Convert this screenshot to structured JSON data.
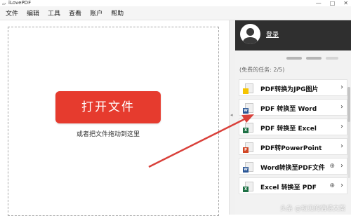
{
  "window": {
    "title": "iLovePDF"
  },
  "menu": [
    "文件",
    "编辑",
    "工具",
    "查看",
    "账户",
    "帮助"
  ],
  "main": {
    "open_button": "打开文件",
    "drop_hint": "或者把文件拖动到这里"
  },
  "account": {
    "login": "登录"
  },
  "free_tasks": "(免费的任务: 2/5)",
  "tools": [
    {
      "label": "PDF转换为JPG图片",
      "icon": "pdf-to-jpg-icon",
      "color": "#f5c400",
      "badge": "",
      "globe": false
    },
    {
      "label": "PDF 转换至 Word",
      "icon": "pdf-to-word-icon",
      "color": "#2b5797",
      "badge": "W",
      "globe": false
    },
    {
      "label": "PDF 转换至 Excel",
      "icon": "pdf-to-excel-icon",
      "color": "#1e7145",
      "badge": "X",
      "globe": false
    },
    {
      "label": "PDF转PowerPoint",
      "icon": "pdf-to-powerpoint-icon",
      "color": "#d24726",
      "badge": "P",
      "globe": false
    },
    {
      "label": "Word转换至PDF文件",
      "icon": "word-to-pdf-icon",
      "color": "#2b5797",
      "badge": "W",
      "globe": true
    },
    {
      "label": "Excel 转换至 PDF",
      "icon": "excel-to-pdf-icon",
      "color": "#1e7145",
      "badge": "X",
      "globe": true
    }
  ],
  "watermark": "头条 @初见的情感文案",
  "colors": {
    "accent": "#e63b2e",
    "header": "#2f2f2f",
    "arrow": "#d9403a"
  }
}
